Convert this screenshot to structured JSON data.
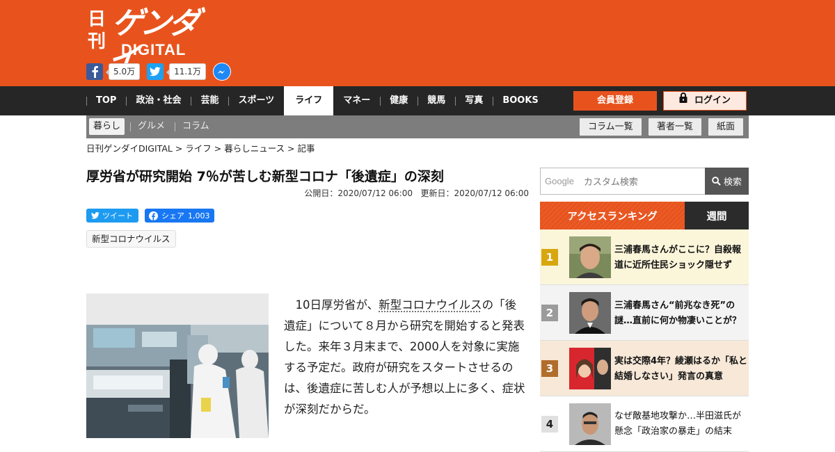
{
  "header": {
    "logo": {
      "kanji": "日刊",
      "katakana": "ゲンダイ",
      "latin": "DIGITAL"
    },
    "social": {
      "facebook_count": "5.0万",
      "twitter_count": "11.1万"
    }
  },
  "nav": {
    "items": [
      {
        "label": "TOP"
      },
      {
        "label": "政治・社会"
      },
      {
        "label": "芸能"
      },
      {
        "label": "スポーツ"
      },
      {
        "label": "ライフ",
        "active": true
      },
      {
        "label": "マネー"
      },
      {
        "label": "健康"
      },
      {
        "label": "競馬"
      },
      {
        "label": "写真"
      },
      {
        "label": "BOOKS"
      }
    ],
    "register_label": "会員登録",
    "login_label": "ログイン"
  },
  "subnav": {
    "items": [
      {
        "label": "暮らし"
      },
      {
        "label": "グルメ"
      },
      {
        "label": "コラム"
      }
    ],
    "buttons": [
      {
        "label": "コラム一覧"
      },
      {
        "label": "著者一覧"
      },
      {
        "label": "紙面"
      }
    ]
  },
  "breadcrumb": "日刊ゲンダイDIGITAL > ライフ > 暮らしニュース > 記事",
  "article": {
    "title": "厚労省が研究開始 7％が苦しむ新型コロナ「後遺症」の深刻",
    "published": "公開日：2020/07/12 06:00",
    "updated": "更新日：2020/07/12 06:00",
    "tweet_label": "ツイート",
    "fb_share_label": "シェア",
    "fb_share_count": "1,003",
    "tag": "新型コロナウイルス",
    "body": {
      "pre": "10日厚労省が、",
      "keyword": "新型コロナウイルス",
      "post": "の「後遺症」について８月から研究を開始すると発表した。来年３月末まで、2000人を対象に実施する予定だ。政府が研究をスタートさせるのは、後遺症に苦しむ人が予想以上に多く、症状が深刻だからだ。"
    }
  },
  "sidebar": {
    "search": {
      "brand": "Google",
      "placeholder": "カスタム検索",
      "button_label": "検索"
    },
    "ranking": {
      "title": "アクセスランキング",
      "period": "週間",
      "items": [
        {
          "rank": "1",
          "text": "三浦春馬さんがここに？自殺報道に近所住民ショック隠せず",
          "badge_color": "#d8a70f",
          "bg": "#fbf5da"
        },
        {
          "rank": "2",
          "text": "三浦春馬さん“前兆なき死”の謎…直前に何か物凄いことが？",
          "badge_color": "#9b9b9b",
          "bg": "#f3f3f3"
        },
        {
          "rank": "3",
          "text": "実は交際4年？綾瀬はるか「私と結婚しなさい」発言の真意",
          "badge_color": "#b06d2b",
          "bg": "#f7e8d8"
        },
        {
          "rank": "4",
          "text": "なぜ敵基地攻撃か…半田滋氏が懸念「政治家の暴走」の結末",
          "badge_color": "#e0e0e0",
          "bg": "#ffffff"
        }
      ]
    }
  }
}
